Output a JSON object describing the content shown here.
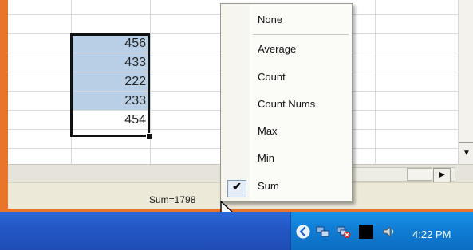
{
  "spreadsheet": {
    "cells": [
      456,
      433,
      222,
      233,
      454
    ]
  },
  "statusbar": {
    "sum_text": "Sum=1798"
  },
  "status_menu": {
    "items": [
      {
        "label": "None",
        "checked": false
      },
      {
        "label": "Average",
        "checked": false
      },
      {
        "label": "Count",
        "checked": false
      },
      {
        "label": "Count Nums",
        "checked": false
      },
      {
        "label": "Max",
        "checked": false
      },
      {
        "label": "Min",
        "checked": false
      },
      {
        "label": "Sum",
        "checked": true
      }
    ]
  },
  "taskbar": {
    "time": "4:22 PM",
    "icons": [
      "chevron-left-icon",
      "network-icon",
      "network-error-icon",
      "black-window-icon",
      "speaker-icon"
    ]
  },
  "colors": {
    "selection": "#b8cfe6",
    "taskbar": "#2457c6",
    "frame": "#e8752a"
  }
}
